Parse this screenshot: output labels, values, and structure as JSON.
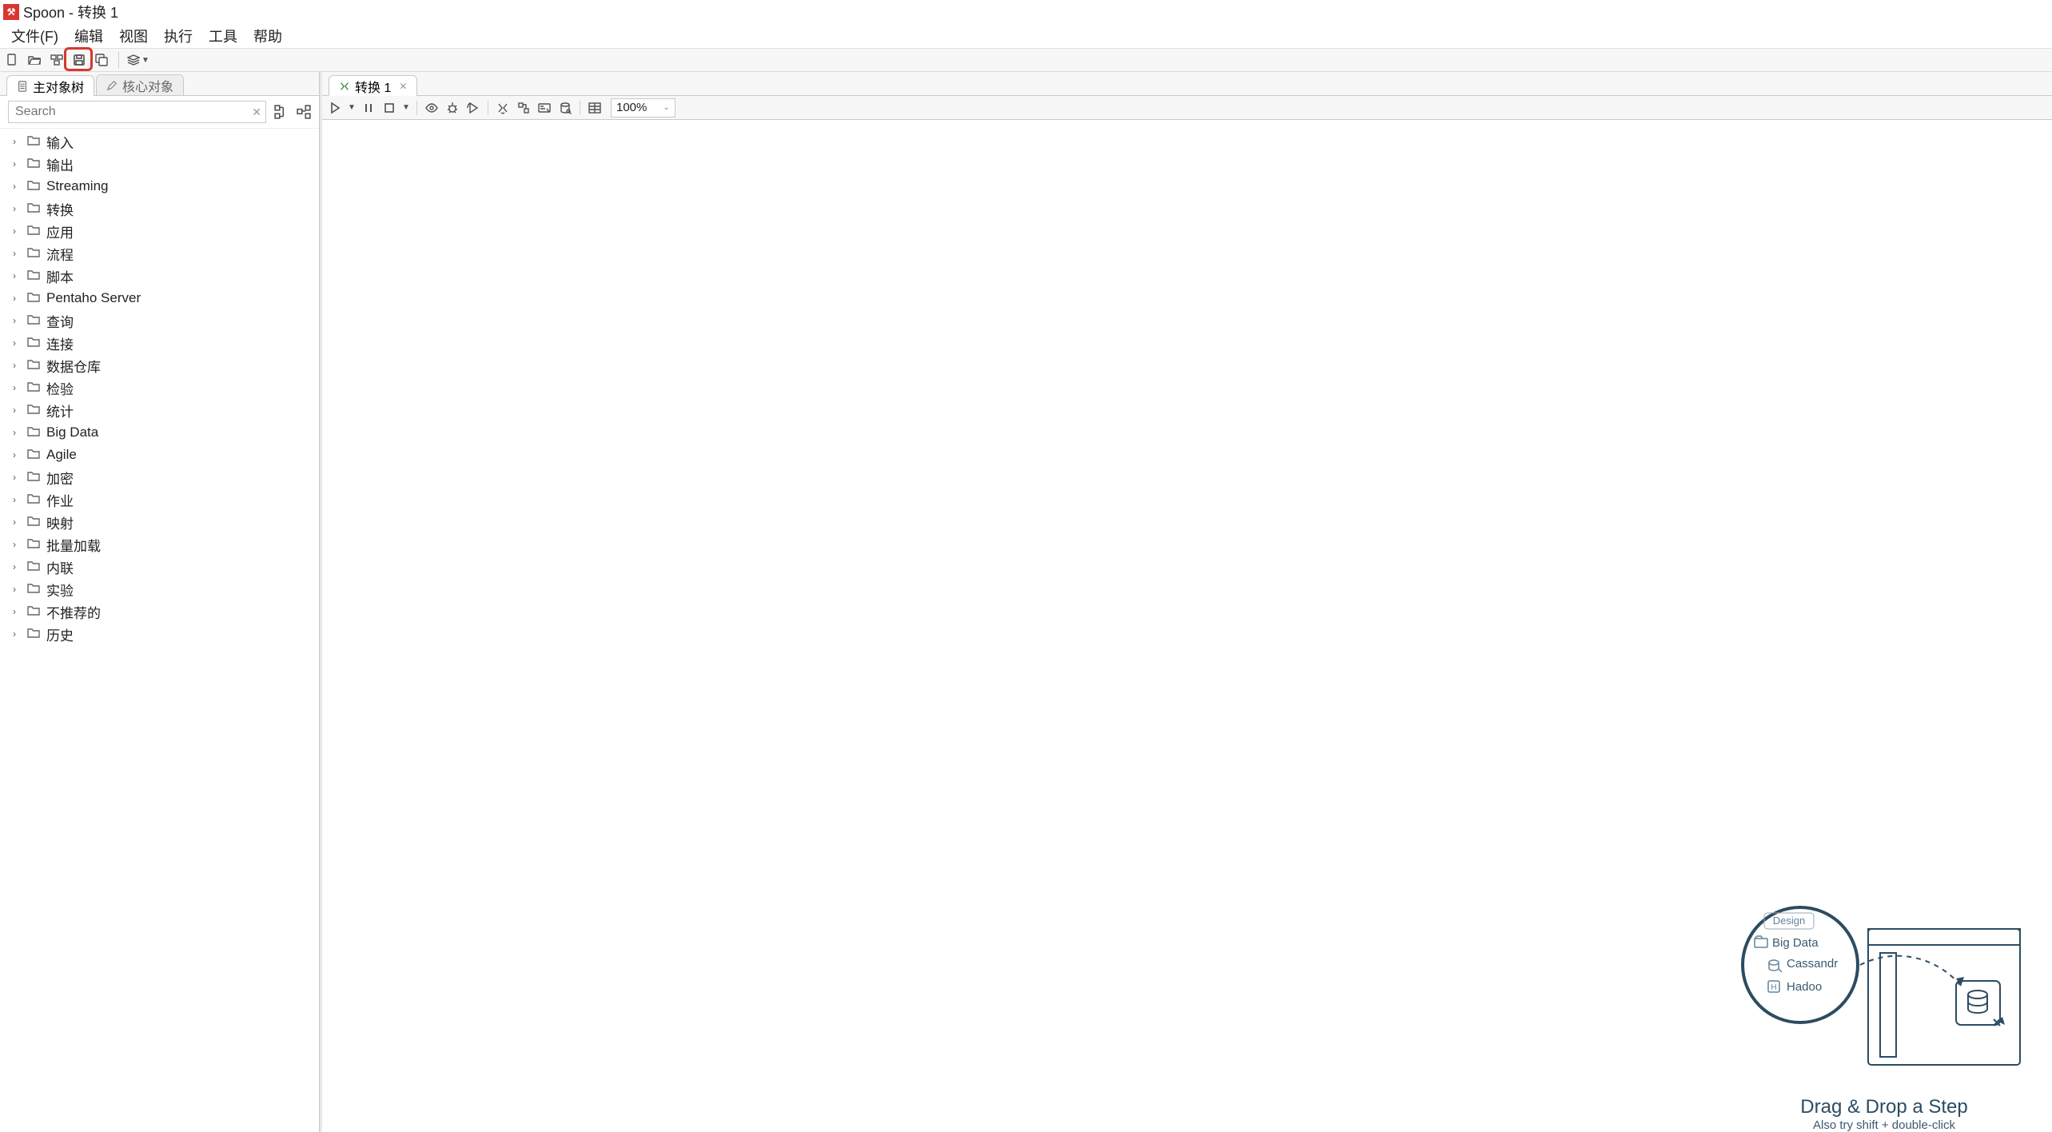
{
  "window": {
    "title": "Spoon - 转换 1"
  },
  "menu": [
    "文件(F)",
    "编辑",
    "视图",
    "执行",
    "工具",
    "帮助"
  ],
  "left_tabs": [
    {
      "label": "主对象树",
      "active": true
    },
    {
      "label": "核心对象",
      "active": false
    }
  ],
  "search": {
    "placeholder": "Search"
  },
  "tree_items": [
    "输入",
    "输出",
    "Streaming",
    "转换",
    "应用",
    "流程",
    "脚本",
    "Pentaho Server",
    "查询",
    "连接",
    "数据仓库",
    "检验",
    "统计",
    "Big Data",
    "Agile",
    "加密",
    "作业",
    "映射",
    "批量加载",
    "内联",
    "实验",
    "不推荐的",
    "历史"
  ],
  "right_tab": {
    "label": "转换 1"
  },
  "zoom": {
    "value": "100%"
  },
  "hint": {
    "design_tab": "Design",
    "folder_label": "Big Data",
    "item1": "Cassandr",
    "item2": "Hadoo",
    "title": "Drag & Drop a Step",
    "subtitle": "Also try shift + double-click"
  }
}
